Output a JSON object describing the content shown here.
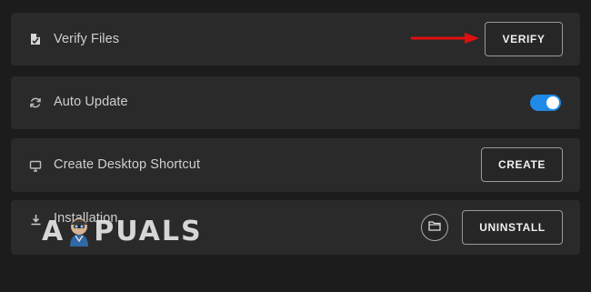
{
  "rows": [
    {
      "label": "Verify Files",
      "icon": "file-icon",
      "action_label": "VERIFY"
    },
    {
      "label": "Auto Update",
      "icon": "refresh-icon",
      "toggle": {
        "state": "on",
        "color": "#1f8ae8"
      }
    },
    {
      "label": "Create Desktop Shortcut",
      "icon": "monitor-icon",
      "action_label": "CREATE"
    },
    {
      "label": "Installation",
      "icon": "download-icon",
      "secondary_icon": "folder-icon",
      "action_label": "UNINSTALL"
    }
  ],
  "annotation": {
    "type": "arrow",
    "color": "#e01010",
    "points_to": "VERIFY"
  },
  "watermark": {
    "text_before": "A",
    "text_after": "PUALS",
    "icon": "appuals-mascot-icon"
  },
  "colors": {
    "background": "#1c1c1c",
    "row_background": "#2a2a2a",
    "accent": "#1f8ae8"
  }
}
